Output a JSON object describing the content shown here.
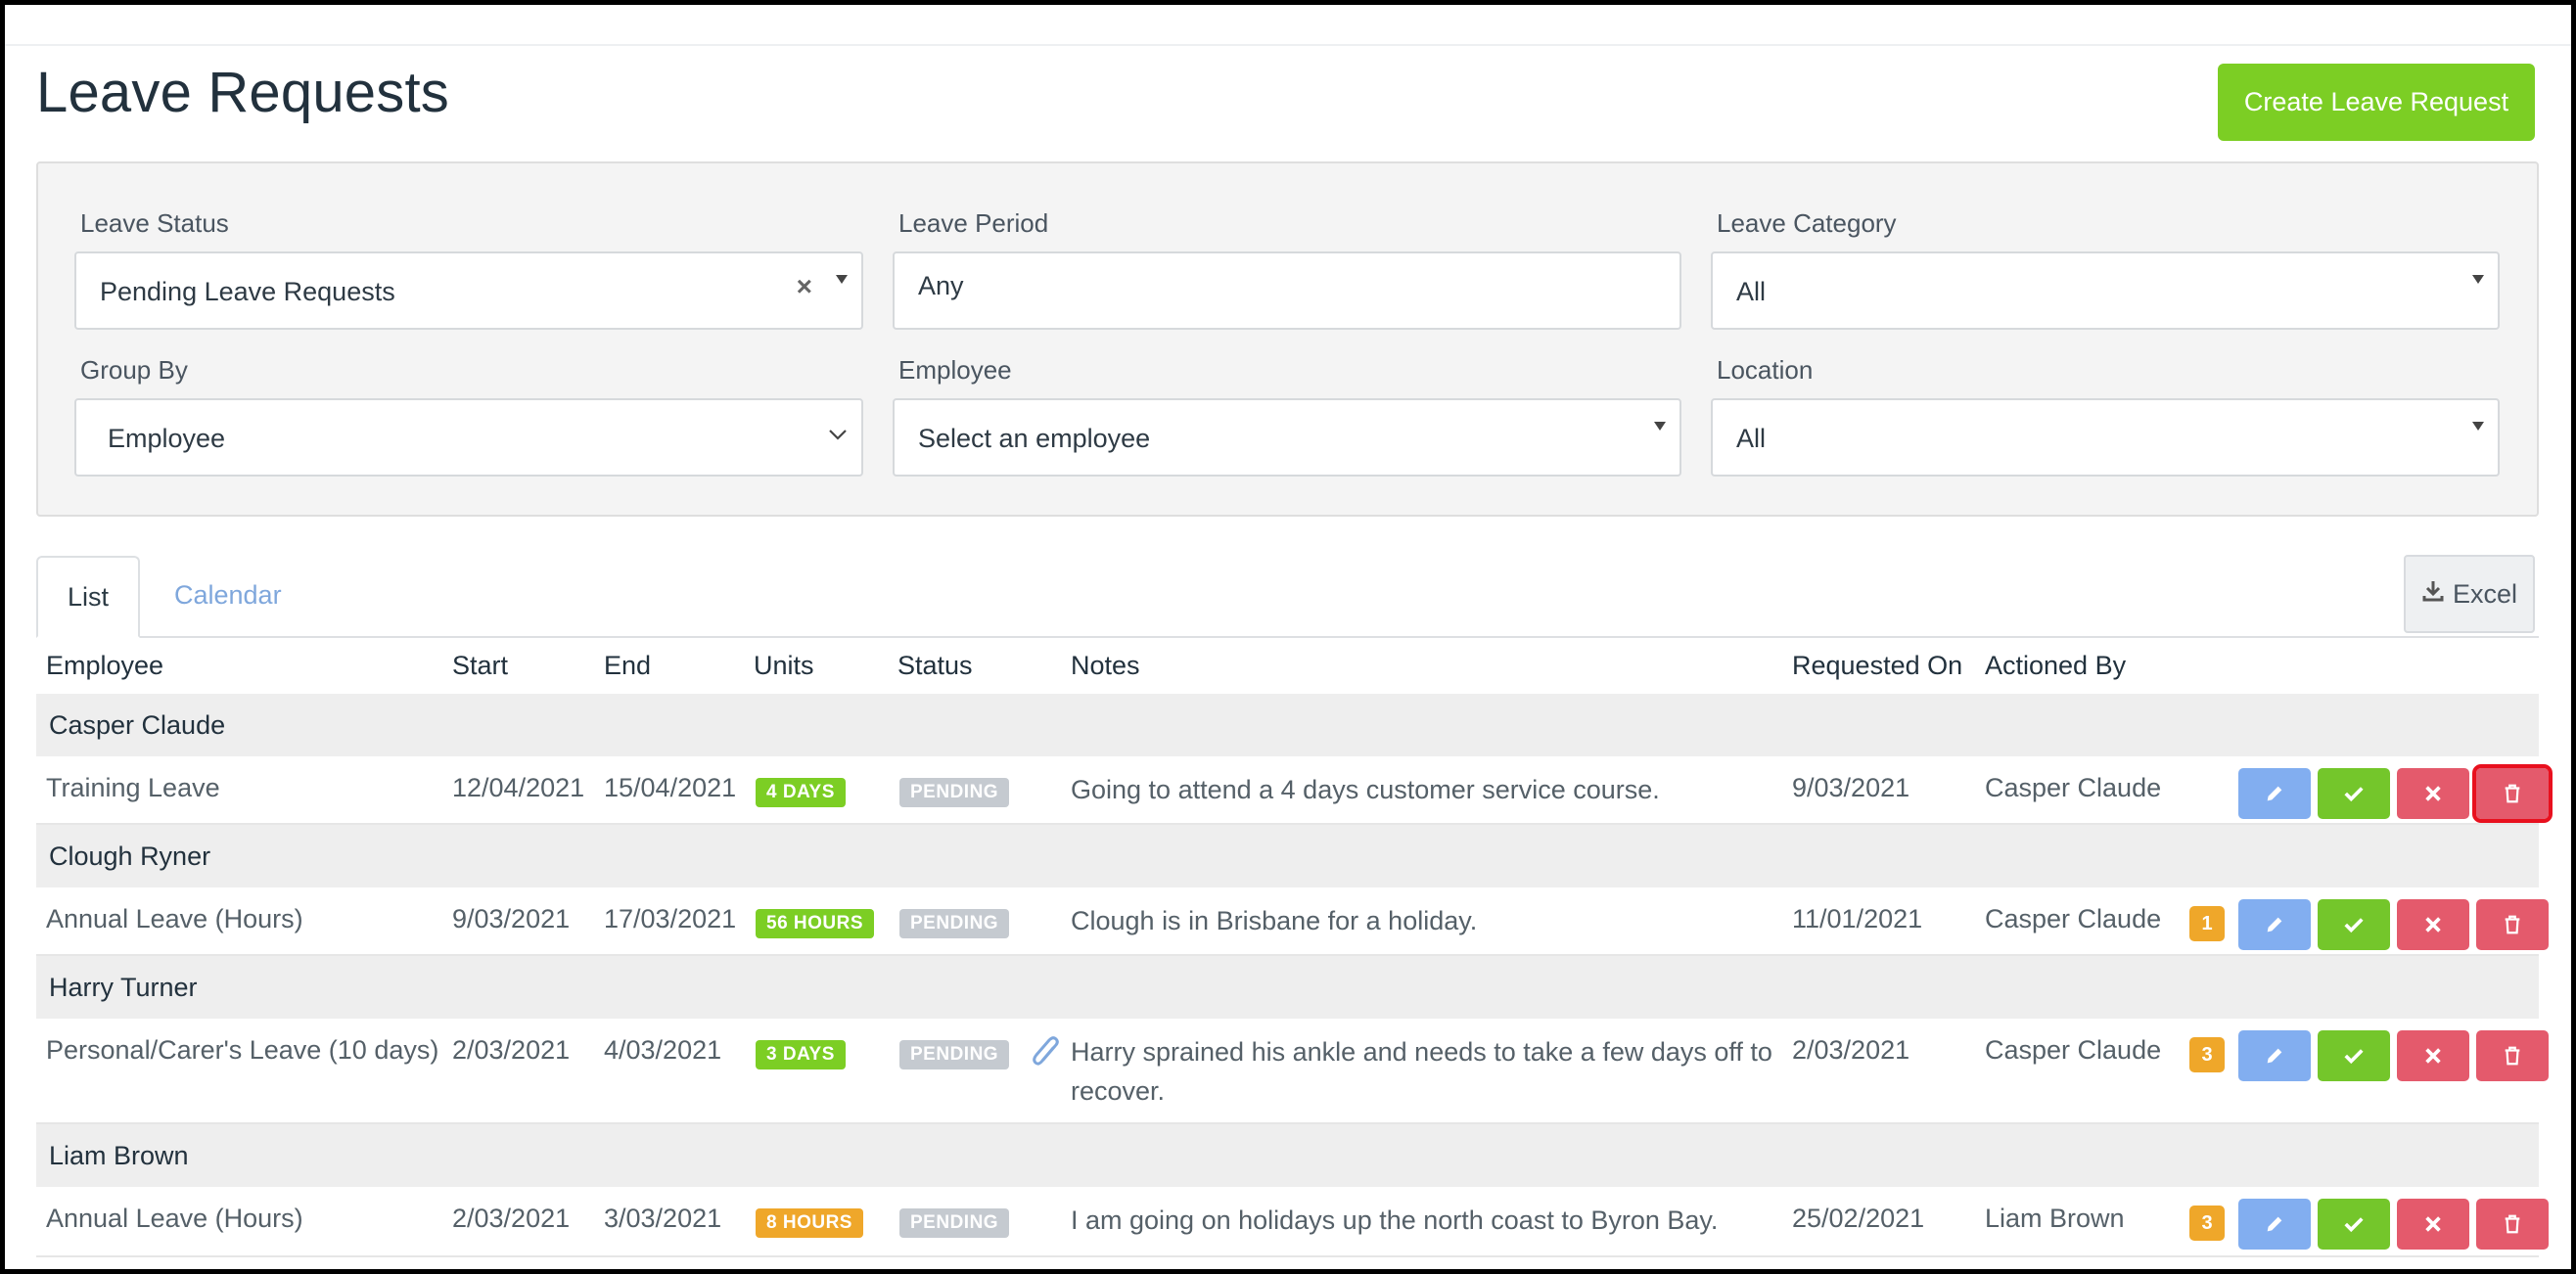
{
  "page": {
    "title": "Leave Requests",
    "create_label": "Create Leave Request"
  },
  "filters": {
    "leave_status": {
      "label": "Leave Status",
      "value": "Pending Leave Requests",
      "clear": "×"
    },
    "leave_period": {
      "label": "Leave Period",
      "value": "Any"
    },
    "leave_category": {
      "label": "Leave Category",
      "value": "All"
    },
    "group_by": {
      "label": "Group By",
      "value": "Employee"
    },
    "employee": {
      "label": "Employee",
      "value": "Select an employee"
    },
    "location": {
      "label": "Location",
      "value": "All"
    }
  },
  "tabs": {
    "list": "List",
    "calendar": "Calendar",
    "excel": "Excel"
  },
  "columns": {
    "employee": "Employee",
    "start": "Start",
    "end": "End",
    "units": "Units",
    "status": "Status",
    "notes": "Notes",
    "requested_on": "Requested On",
    "actioned_by": "Actioned By"
  },
  "groups": [
    {
      "name": "Casper Claude",
      "row": {
        "type": "Training Leave",
        "start": "12/04/2021",
        "end": "15/04/2021",
        "units": "4 DAYS",
        "status": "PENDING",
        "notes": "Going to attend a 4 days customer service course.",
        "requested_on": "9/03/2021",
        "actioned_by": "Casper Claude",
        "count": ""
      }
    },
    {
      "name": "Clough Ryner",
      "row": {
        "type": "Annual Leave (Hours)",
        "start": "9/03/2021",
        "end": "17/03/2021",
        "units": "56 HOURS",
        "status": "PENDING",
        "notes": "Clough is in Brisbane for a holiday.",
        "requested_on": "11/01/2021",
        "actioned_by": "Casper Claude",
        "count": "1"
      }
    },
    {
      "name": "Harry Turner",
      "row": {
        "type": "Personal/Carer's Leave (10 days)",
        "start": "2/03/2021",
        "end": "4/03/2021",
        "units": "3 DAYS",
        "status": "PENDING",
        "notes": "Harry sprained his ankle and needs to take a few days off to recover.",
        "requested_on": "2/03/2021",
        "actioned_by": "Casper Claude",
        "count": "3"
      }
    },
    {
      "name": "Liam Brown",
      "row": {
        "type": "Annual Leave (Hours)",
        "start": "2/03/2021",
        "end": "3/03/2021",
        "units": "8 HOURS",
        "status": "PENDING",
        "notes": "I am going on holidays up the north coast to Byron Bay.",
        "requested_on": "25/02/2021",
        "actioned_by": "Liam Brown",
        "count": "3"
      }
    }
  ],
  "colors": {
    "units_green": "#7cce24",
    "units_orange": "#efa72a",
    "accent_blue": "#82aef0",
    "danger": "#e45a6c"
  }
}
